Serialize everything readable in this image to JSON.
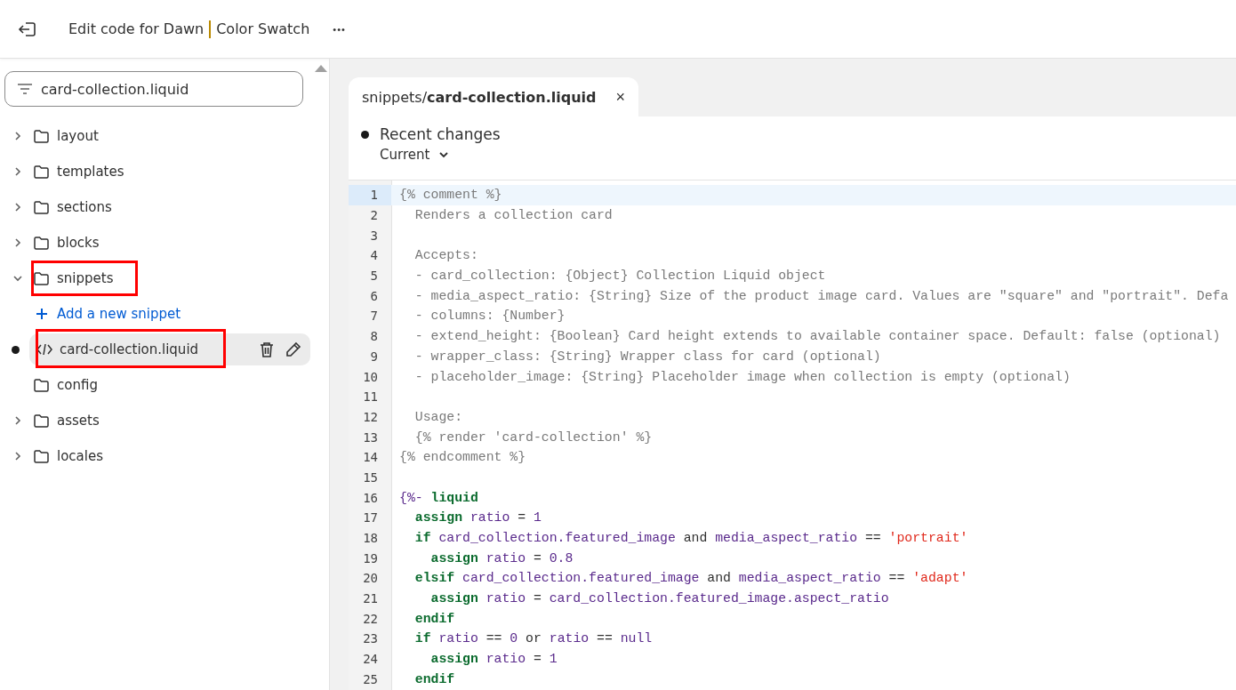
{
  "header": {
    "title_main": "Edit code for Dawn",
    "title_theme": "Color Swatch",
    "more_label": "•••"
  },
  "sidebar": {
    "search": {
      "value": "card-collection.liquid"
    },
    "tree": [
      {
        "kind": "folder",
        "label": "layout",
        "expanded": false,
        "annotated": false
      },
      {
        "kind": "folder",
        "label": "templates",
        "expanded": false,
        "annotated": false
      },
      {
        "kind": "folder",
        "label": "sections",
        "expanded": false,
        "annotated": false
      },
      {
        "kind": "folder",
        "label": "blocks",
        "expanded": false,
        "annotated": false
      },
      {
        "kind": "folder",
        "label": "snippets",
        "expanded": true,
        "annotated": true,
        "children": [
          {
            "kind": "action",
            "label": "Add a new snippet"
          },
          {
            "kind": "file",
            "label": "card-collection.liquid",
            "selected": true,
            "modified": true,
            "annotated": true
          }
        ]
      },
      {
        "kind": "plain_folder",
        "label": "config",
        "annotated": false
      },
      {
        "kind": "folder",
        "label": "assets",
        "expanded": false,
        "annotated": false
      },
      {
        "kind": "folder",
        "label": "locales",
        "expanded": false,
        "annotated": false
      }
    ]
  },
  "editor": {
    "tab": {
      "path": "snippets/",
      "file": "card-collection.liquid",
      "close": "×",
      "selected": true
    },
    "changes": {
      "title": "Recent changes",
      "version": "Current"
    },
    "lines": [
      {
        "number": "1",
        "current": true,
        "tokens": [
          {
            "kind": "comment",
            "text": "{% comment %}"
          }
        ]
      },
      {
        "number": "2",
        "current": false,
        "tokens": [
          {
            "kind": "comment",
            "text": "  Renders a collection card"
          }
        ]
      },
      {
        "number": "3",
        "current": false
      },
      {
        "number": "4",
        "current": false,
        "tokens": [
          {
            "kind": "comment",
            "text": "  Accepts:"
          }
        ]
      },
      {
        "number": "5",
        "current": false,
        "tokens": [
          {
            "kind": "comment",
            "text": "  - card_collection: {Object} Collection Liquid object"
          }
        ]
      },
      {
        "number": "6",
        "current": false,
        "tokens": [
          {
            "kind": "comment",
            "text": "  - media_aspect_ratio: {String} Size of the product image card. Values are \"square\" and \"portrait\". Defa"
          }
        ]
      },
      {
        "number": "7",
        "current": false,
        "tokens": [
          {
            "kind": "comment",
            "text": "  - columns: {Number}"
          }
        ]
      },
      {
        "number": "8",
        "current": false,
        "tokens": [
          {
            "kind": "comment",
            "text": "  - extend_height: {Boolean} Card height extends to available container space. Default: false (optional)"
          }
        ]
      },
      {
        "number": "9",
        "current": false,
        "tokens": [
          {
            "kind": "comment",
            "text": "  - wrapper_class: {String} Wrapper class for card (optional)"
          }
        ]
      },
      {
        "number": "10",
        "current": false,
        "tokens": [
          {
            "kind": "comment",
            "text": "  - placeholder_image: {String} Placeholder image when collection is empty (optional)"
          }
        ]
      },
      {
        "number": "11",
        "current": false
      },
      {
        "number": "12",
        "current": false,
        "tokens": [
          {
            "kind": "comment",
            "text": "  Usage:"
          }
        ]
      },
      {
        "number": "13",
        "current": false,
        "tokens": [
          {
            "kind": "comment",
            "text": "  {% render 'card-collection' %}"
          }
        ]
      },
      {
        "number": "14",
        "current": false,
        "tokens": [
          {
            "kind": "comment",
            "text": "{% endcomment %}"
          }
        ]
      },
      {
        "number": "15",
        "current": false
      },
      {
        "number": "16",
        "current": false,
        "tokens": [
          {
            "kind": "name",
            "text": "{%- "
          },
          {
            "kind": "keyword",
            "text": "liquid"
          }
        ]
      },
      {
        "number": "17",
        "current": false,
        "tokens": [
          {
            "kind": "keyword",
            "text": "  assign"
          },
          {
            "kind": "name",
            "text": " ratio"
          },
          {
            "kind": "plain",
            "text": " = "
          },
          {
            "kind": "name",
            "text": "1"
          }
        ]
      },
      {
        "number": "18",
        "current": false,
        "tokens": [
          {
            "kind": "keyword",
            "text": "  if"
          },
          {
            "kind": "name",
            "text": " card_collection.featured_image"
          },
          {
            "kind": "plain",
            "text": " and "
          },
          {
            "kind": "name",
            "text": "media_aspect_ratio"
          },
          {
            "kind": "plain",
            "text": " == "
          },
          {
            "kind": "string",
            "text": "'portrait'"
          }
        ]
      },
      {
        "number": "19",
        "current": false,
        "tokens": [
          {
            "kind": "keyword",
            "text": "    assign"
          },
          {
            "kind": "name",
            "text": " ratio"
          },
          {
            "kind": "plain",
            "text": " = "
          },
          {
            "kind": "name",
            "text": "0.8"
          }
        ]
      },
      {
        "number": "20",
        "current": false,
        "tokens": [
          {
            "kind": "keyword",
            "text": "  elsif"
          },
          {
            "kind": "name",
            "text": " card_collection.featured_image"
          },
          {
            "kind": "plain",
            "text": " and "
          },
          {
            "kind": "name",
            "text": "media_aspect_ratio"
          },
          {
            "kind": "plain",
            "text": " == "
          },
          {
            "kind": "string",
            "text": "'adapt'"
          }
        ]
      },
      {
        "number": "21",
        "current": false,
        "tokens": [
          {
            "kind": "keyword",
            "text": "    assign"
          },
          {
            "kind": "name",
            "text": " ratio"
          },
          {
            "kind": "plain",
            "text": " = "
          },
          {
            "kind": "name",
            "text": "card_collection.featured_image.aspect_ratio"
          }
        ]
      },
      {
        "number": "22",
        "current": false,
        "tokens": [
          {
            "kind": "keyword",
            "text": "  endif"
          }
        ]
      },
      {
        "number": "23",
        "current": false,
        "tokens": [
          {
            "kind": "keyword",
            "text": "  if"
          },
          {
            "kind": "name",
            "text": " ratio"
          },
          {
            "kind": "plain",
            "text": " == "
          },
          {
            "kind": "name",
            "text": "0"
          },
          {
            "kind": "plain",
            "text": " or "
          },
          {
            "kind": "name",
            "text": "ratio"
          },
          {
            "kind": "plain",
            "text": " == "
          },
          {
            "kind": "name",
            "text": "null"
          }
        ]
      },
      {
        "number": "24",
        "current": false,
        "tokens": [
          {
            "kind": "keyword",
            "text": "    assign"
          },
          {
            "kind": "name",
            "text": " ratio"
          },
          {
            "kind": "plain",
            "text": " = "
          },
          {
            "kind": "name",
            "text": "1"
          }
        ]
      },
      {
        "number": "25",
        "current": false,
        "tokens": [
          {
            "kind": "keyword",
            "text": "  endif"
          }
        ]
      }
    ]
  }
}
